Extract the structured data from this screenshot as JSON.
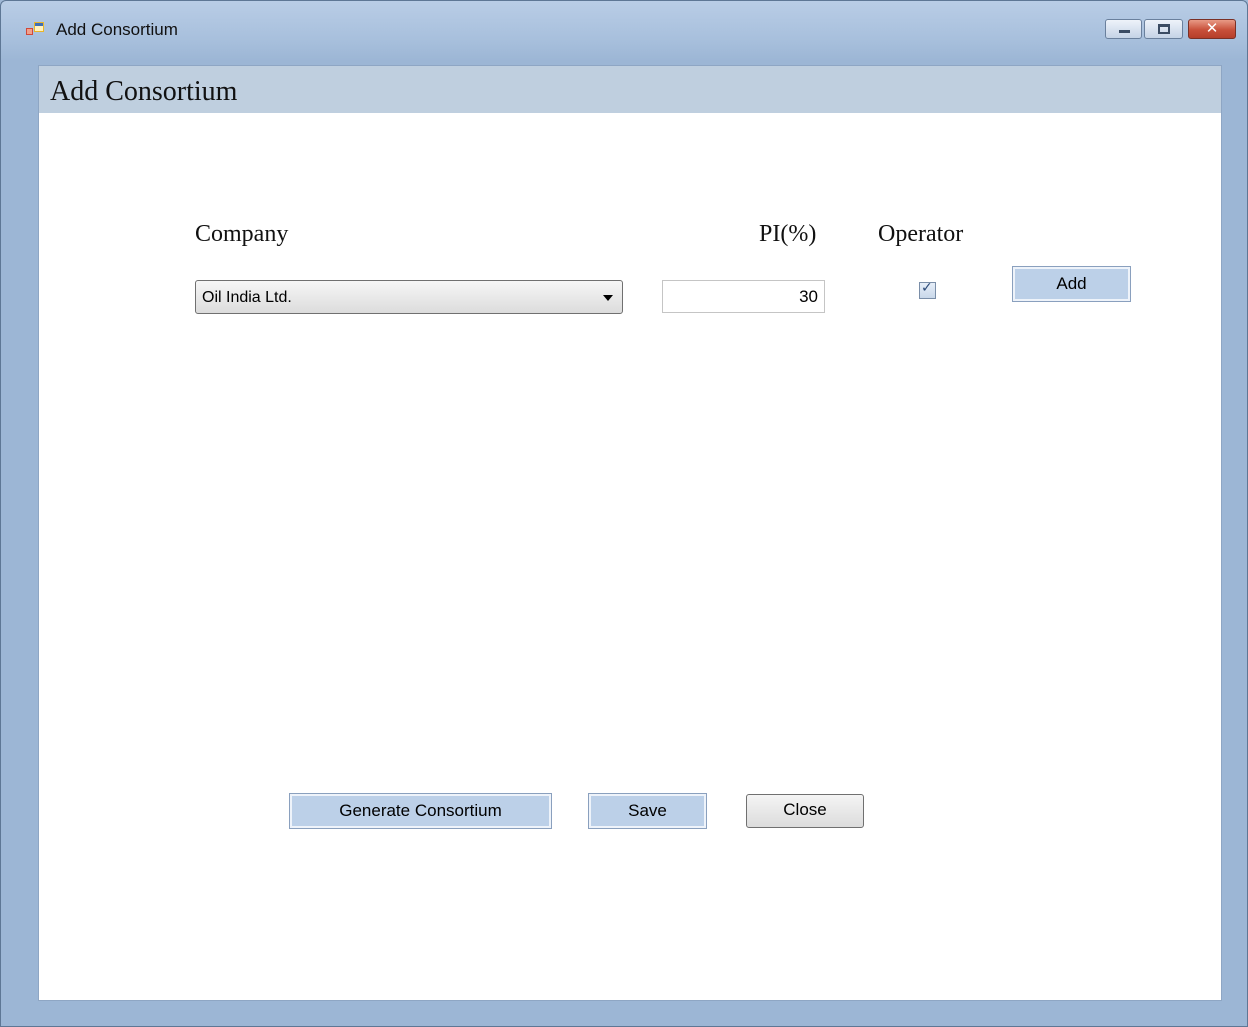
{
  "window": {
    "title": "Add Consortium",
    "controls": {
      "minimize_icon": "minimize-icon",
      "maximize_icon": "maximize-icon",
      "close_icon": "close-icon",
      "close_glyph": "✕"
    }
  },
  "page": {
    "title": "Add Consortium"
  },
  "form": {
    "company_label": "Company",
    "pi_label": "PI(%)",
    "operator_label": "Operator",
    "company_value": "Oil India Ltd.",
    "pi_value": "30",
    "operator_checked": true,
    "check_glyph": "✓",
    "add_label": "Add"
  },
  "actions": {
    "generate_label": "Generate Consortium",
    "save_label": "Save",
    "close_label": "Close"
  },
  "colors": {
    "frame": "#9fb8d6",
    "header_band": "#bfcfdf",
    "button_blue": "#bcd0e8",
    "close_button_red": "#c8503a"
  }
}
